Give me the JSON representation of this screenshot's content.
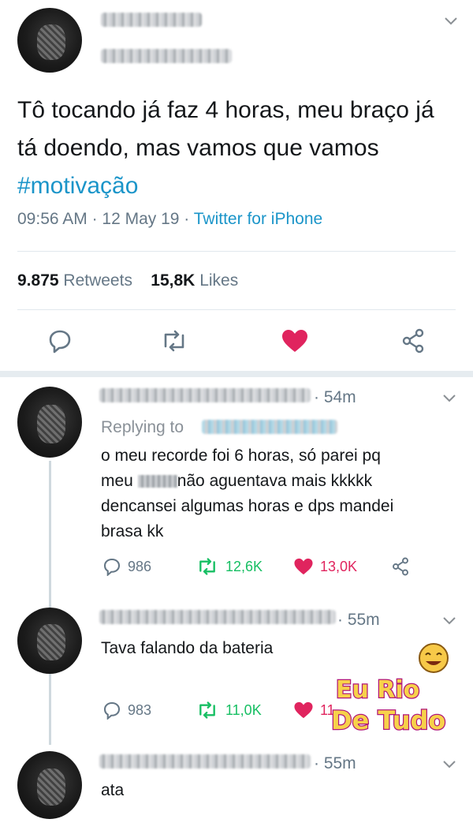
{
  "main_tweet": {
    "text_before_hashtag": "Tô tocando já faz 4 horas, meu braço já tá doendo, mas vamos que vamos ",
    "hashtag": "#motivação",
    "time": "09:56 AM",
    "date": "12 May 19",
    "source": "Twitter for iPhone",
    "sep": " · ",
    "retweets_count": "9.875",
    "retweets_label": "Retweets",
    "likes_count": "15,8K",
    "likes_label": "Likes"
  },
  "replies": [
    {
      "time": "· 54m",
      "replying_label": "Replying to",
      "text": "o meu recorde foi 6 horas, só parei pq meu [censored] não aguentava mais kkkkk dencansei algumas horas e dps mandei brasa kk",
      "text_part1": "o meu recorde foi 6 horas, só parei pq",
      "text_part2_prefix": "meu",
      "text_part2_suffix": "não aguentava mais kkkkk",
      "text_part3": "dencansei algumas horas e dps mandei",
      "text_part4": "brasa kk",
      "replies": "986",
      "retweets": "12,6K",
      "likes": "13,0K"
    },
    {
      "time": "· 55m",
      "text": "Tava falando da bateria",
      "replies": "983",
      "retweets": "11,0K",
      "likes": "11,"
    },
    {
      "time": "· 55m",
      "text": "ata"
    }
  ],
  "watermark": {
    "line1": "Eu Rio",
    "line2": "De Tudo"
  },
  "colors": {
    "link": "#1b95c9",
    "retweet": "#17bf63",
    "like": "#e0245e",
    "muted": "#657786"
  },
  "icons": [
    "reply-icon",
    "retweet-icon",
    "heart-icon",
    "share-icon",
    "chevron-down-icon"
  ]
}
